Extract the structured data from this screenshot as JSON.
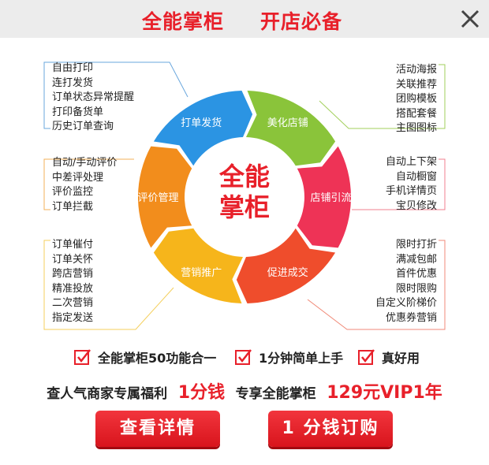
{
  "header": {
    "title_left": "全能掌柜",
    "title_right": "开店必备",
    "close_icon": "close-icon"
  },
  "wheel": {
    "logo_line1": "全能",
    "logo_line2": "掌柜",
    "segments": [
      {
        "label": "打单发货",
        "color": "#2b94e3"
      },
      {
        "label": "美化店铺",
        "color": "#8ac43a"
      },
      {
        "label": "店铺引流",
        "color": "#ee3356"
      },
      {
        "label": "促进成交",
        "color": "#ef4d2c"
      },
      {
        "label": "营销推广",
        "color": "#f6b51b"
      },
      {
        "label": "评价管理",
        "color": "#f28d1c"
      }
    ]
  },
  "lists": {
    "dadan": [
      "自由打印",
      "连打发货",
      "订单状态异常提醒",
      "打印备货单",
      "历史订单查询"
    ],
    "meihua": [
      "活动海报",
      "关联推荐",
      "团购模板",
      "搭配套餐",
      "主图图标"
    ],
    "pingjia": [
      "自动/手动评价",
      "中差评处理",
      "评价监控",
      "订单拦截"
    ],
    "yinliu": [
      "自动上下架",
      "自动橱窗",
      "手机详情页",
      "宝贝修改"
    ],
    "yingxiao": [
      "订单催付",
      "订单关怀",
      "跨店营销",
      "精准投放",
      "二次营销",
      "指定发送"
    ],
    "chengjiao": [
      "限时打折",
      "满减包邮",
      "首件优惠",
      "限时限购",
      "自定义阶梯价",
      "优惠券营销"
    ]
  },
  "features": [
    "全能掌柜50功能合一",
    "1分钟简单上手",
    "真好用"
  ],
  "promo": {
    "text1": "查人气商家专属福利",
    "price1": "1分钱",
    "text2": "专享全能掌柜",
    "price2": "129元VIP1年"
  },
  "buttons": {
    "details": "查看详情",
    "order": "1 分钱订购"
  },
  "colors": {
    "brand_red": "#e8202a",
    "header_bg": "#ececec",
    "line_blue": "#6aa7dd",
    "line_green": "#a2cf5b",
    "line_red": "#f07f8f",
    "line_orange": "#f3b25a",
    "line_yellow": "#f4cf5c",
    "line_redorange": "#f08a78"
  }
}
